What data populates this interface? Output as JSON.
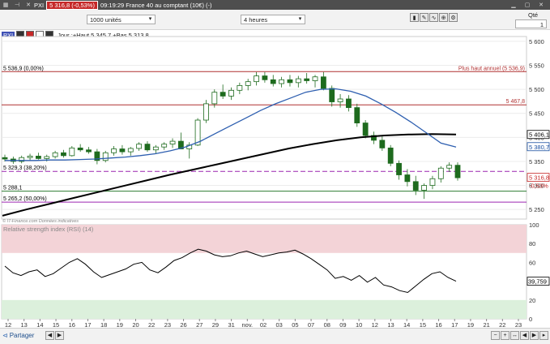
{
  "topbar": {
    "icons": [
      "logo-icon",
      "pin-icon",
      "close-icon"
    ],
    "instrument": "PXI",
    "price_badge": "5 316,8 (-0,53%)",
    "title": "09:19:29 France 40 au comptant (10€) (-)"
  },
  "toolbar": {
    "units_value": "1000 unités",
    "period_value": "4 heures",
    "quantity_label": "Qté",
    "quantity_value": "1"
  },
  "legend": {
    "instrument": "PXI",
    "ohlc_text": "Jour :+Haut 5 345,7 +Bas 5 313,8"
  },
  "chart_data": {
    "type": "candlestick",
    "title": "",
    "y_ticks": [
      "5 600",
      "5 550",
      "5 500",
      "5 450",
      "5 400",
      "5 350",
      "5 300",
      "5 250"
    ],
    "x_ticks": [
      "12",
      "13",
      "14",
      "15",
      "16",
      "17",
      "18",
      "19",
      "20",
      "22",
      "23",
      "26",
      "27",
      "29",
      "31",
      "nov.",
      "02",
      "03",
      "05",
      "07",
      "08",
      "09",
      "10",
      "12",
      "13",
      "14",
      "15",
      "16",
      "17",
      "19",
      "21",
      "22",
      "23"
    ],
    "ylim": [
      5230,
      5610
    ],
    "levels": [
      {
        "label": "5 536,9 (0,00%)",
        "value": 5536.9,
        "color": "#b03030",
        "style": "solid"
      },
      {
        "label": "Plus haut annuel (5 536,9)",
        "value": 5536.9,
        "color": "#b03030",
        "style": "solid"
      },
      {
        "label": "5 467,8",
        "value": 5467.8,
        "color": "#b03030",
        "style": "solid"
      },
      {
        "label": "5 329,3 (38,20%)",
        "value": 5329.3,
        "color": "#9c27b0",
        "style": "dashed"
      },
      {
        "label": "5 288,1",
        "value": 5288.1,
        "color": "#2e7d32",
        "style": "solid"
      },
      {
        "label": "5 265,2 (50,00%)",
        "value": 5265.2,
        "color": "#9c27b0",
        "style": "solid"
      }
    ],
    "price_labels": [
      {
        "label": "5 406,1",
        "value": 5406.1,
        "color": "#000000"
      },
      {
        "label": "5 380,7",
        "value": 5380.7,
        "color": "#1a4fa0"
      },
      {
        "label": "5 316,8",
        "value": 5316.8,
        "color": "#c62828"
      }
    ],
    "change_label": "-0,53%",
    "watermark": "© IT-Finance.com Données indicatives",
    "candles": [
      [
        5358,
        5364,
        5350,
        5355
      ],
      [
        5355,
        5360,
        5345,
        5350
      ],
      [
        5350,
        5362,
        5346,
        5358
      ],
      [
        5358,
        5366,
        5352,
        5361
      ],
      [
        5361,
        5368,
        5354,
        5356
      ],
      [
        5356,
        5364,
        5350,
        5360
      ],
      [
        5360,
        5372,
        5356,
        5368
      ],
      [
        5368,
        5374,
        5358,
        5362
      ],
      [
        5362,
        5382,
        5360,
        5378
      ],
      [
        5378,
        5386,
        5370,
        5374
      ],
      [
        5374,
        5380,
        5366,
        5370
      ],
      [
        5370,
        5376,
        5344,
        5352
      ],
      [
        5352,
        5372,
        5348,
        5368
      ],
      [
        5368,
        5382,
        5362,
        5376
      ],
      [
        5376,
        5384,
        5364,
        5370
      ],
      [
        5370,
        5380,
        5362,
        5377
      ],
      [
        5377,
        5390,
        5372,
        5386
      ],
      [
        5386,
        5392,
        5370,
        5374
      ],
      [
        5374,
        5384,
        5366,
        5380
      ],
      [
        5380,
        5390,
        5374,
        5386
      ],
      [
        5386,
        5398,
        5378,
        5392
      ],
      [
        5392,
        5410,
        5382,
        5376
      ],
      [
        5376,
        5390,
        5356,
        5384
      ],
      [
        5384,
        5440,
        5382,
        5436
      ],
      [
        5436,
        5478,
        5430,
        5470
      ],
      [
        5470,
        5500,
        5462,
        5494
      ],
      [
        5494,
        5510,
        5480,
        5486
      ],
      [
        5486,
        5504,
        5478,
        5498
      ],
      [
        5498,
        5514,
        5490,
        5508
      ],
      [
        5508,
        5522,
        5498,
        5516
      ],
      [
        5516,
        5536,
        5508,
        5528
      ],
      [
        5528,
        5536,
        5514,
        5520
      ],
      [
        5520,
        5530,
        5506,
        5512
      ],
      [
        5512,
        5526,
        5504,
        5520
      ],
      [
        5520,
        5530,
        5506,
        5514
      ],
      [
        5514,
        5528,
        5504,
        5522
      ],
      [
        5522,
        5534,
        5512,
        5518
      ],
      [
        5518,
        5530,
        5504,
        5526
      ],
      [
        5526,
        5536,
        5498,
        5502
      ],
      [
        5502,
        5508,
        5464,
        5474
      ],
      [
        5474,
        5490,
        5462,
        5480
      ],
      [
        5480,
        5488,
        5454,
        5462
      ],
      [
        5462,
        5470,
        5422,
        5430
      ],
      [
        5430,
        5436,
        5398,
        5404
      ],
      [
        5404,
        5412,
        5386,
        5394
      ],
      [
        5394,
        5402,
        5372,
        5378
      ],
      [
        5378,
        5384,
        5340,
        5346
      ],
      [
        5346,
        5352,
        5312,
        5322
      ],
      [
        5322,
        5334,
        5298,
        5308
      ],
      [
        5308,
        5320,
        5280,
        5290
      ],
      [
        5290,
        5304,
        5272,
        5300
      ],
      [
        5300,
        5320,
        5292,
        5314
      ],
      [
        5314,
        5340,
        5306,
        5336
      ],
      [
        5336,
        5348,
        5328,
        5342
      ],
      [
        5342,
        5348,
        5310,
        5316
      ]
    ],
    "ma_blue": [
      5352,
      5352,
      5352,
      5353,
      5353,
      5354,
      5355,
      5357,
      5359,
      5362,
      5366,
      5372,
      5380,
      5392,
      5408,
      5424,
      5440,
      5456,
      5470,
      5482,
      5494,
      5500,
      5501,
      5496,
      5486,
      5470,
      5452,
      5432,
      5410,
      5388,
      5380
    ],
    "ma_black": [
      5237,
      5250,
      5262,
      5274,
      5286,
      5298,
      5310,
      5322,
      5333,
      5344,
      5355,
      5366,
      5377,
      5386,
      5394,
      5400,
      5404,
      5406,
      5407,
      5406
    ],
    "rsi": {
      "title": "Relative strength index (RSI) (14)",
      "y_ticks": [
        "100",
        "80",
        "60",
        "40",
        "20",
        "0"
      ],
      "value_label": "39,759",
      "values": [
        56,
        49,
        46,
        50,
        52,
        45,
        48,
        54,
        60,
        64,
        58,
        50,
        44,
        47,
        50,
        53,
        58,
        60,
        52,
        49,
        55,
        62,
        65,
        70,
        74,
        72,
        68,
        66,
        67,
        70,
        72,
        69,
        66,
        68,
        70,
        71,
        73,
        69,
        64,
        58,
        52,
        43,
        45,
        41,
        46,
        39,
        44,
        36,
        34,
        30,
        28,
        35,
        42,
        48,
        50,
        44,
        40
      ]
    }
  },
  "bottombar": {
    "share_label": "Partager"
  }
}
